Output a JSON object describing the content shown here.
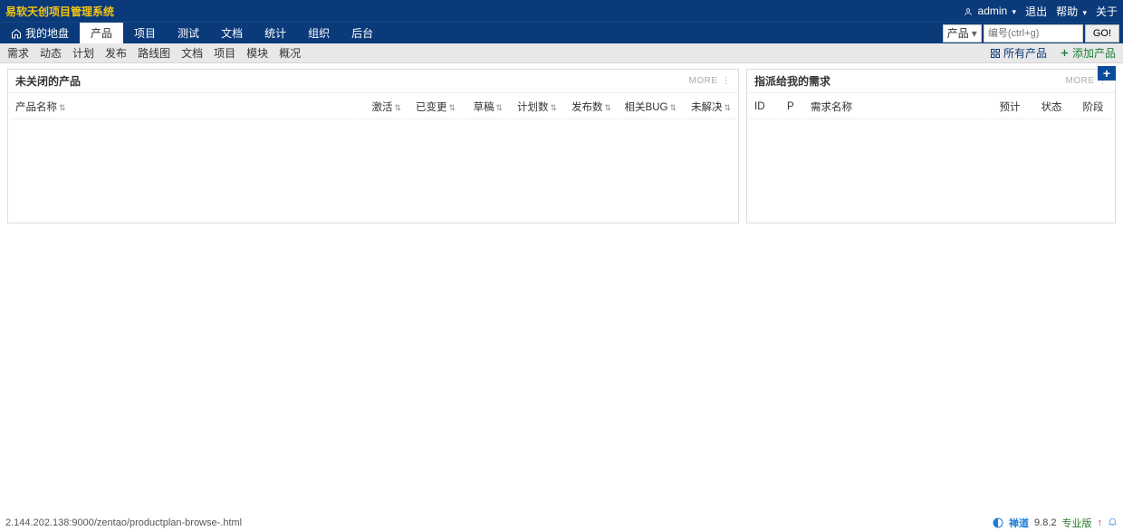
{
  "brand": "易软天创项目管理系统",
  "topright": {
    "user": "admin",
    "logout": "退出",
    "help": "帮助",
    "about": "关于"
  },
  "nav": {
    "home": "我的地盘",
    "tabs": [
      "产品",
      "项目",
      "测试",
      "文档",
      "统计",
      "组织",
      "后台"
    ],
    "active": "产品"
  },
  "search": {
    "scope": "产品",
    "placeholder": "编号(ctrl+g)",
    "go": "GO!"
  },
  "subnav": {
    "items": [
      "需求",
      "动态",
      "计划",
      "发布",
      "路线图",
      "文档",
      "项目",
      "模块",
      "概况"
    ],
    "all": "所有产品",
    "add": "添加产品"
  },
  "panels": {
    "left": {
      "title": "未关闭的产品",
      "more": "MORE",
      "cols": [
        "产品名称",
        "激活",
        "已变更",
        "草稿",
        "计划数",
        "发布数",
        "相关BUG",
        "未解决"
      ]
    },
    "right": {
      "title": "指派给我的需求",
      "more": "MORE",
      "cols": [
        "ID",
        "P",
        "需求名称",
        "预计",
        "状态",
        "阶段"
      ]
    }
  },
  "footer": {
    "url": "2.144.202.138:9000/zentao/productplan-browse-.html",
    "app": "禅道",
    "version": "9.8.2",
    "edition": "专业版"
  }
}
